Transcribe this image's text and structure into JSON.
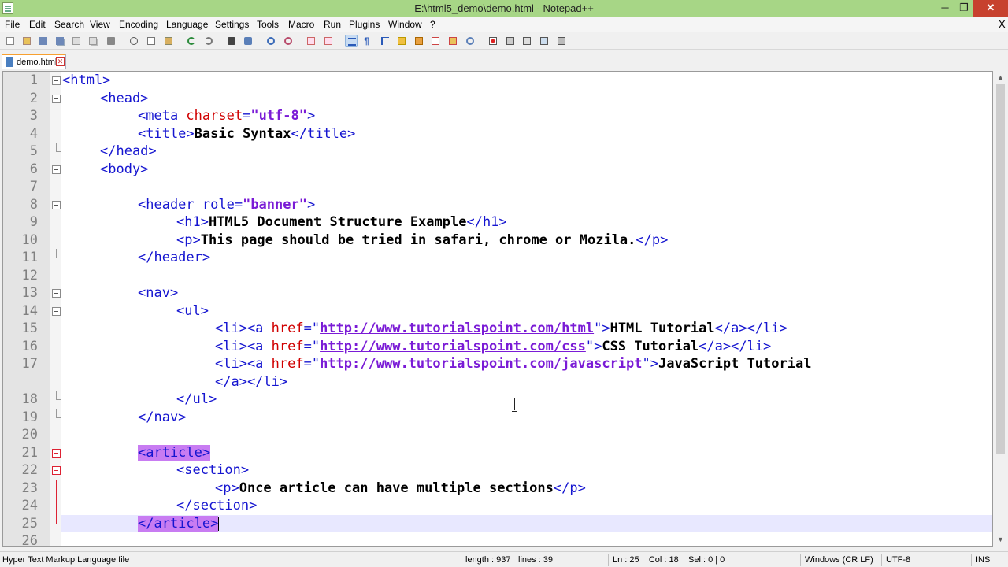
{
  "window": {
    "title": "E:\\html5_demo\\demo.html - Notepad++",
    "minimize_label": "─",
    "maximize_label": "❐",
    "close_label": "✕"
  },
  "menubar": {
    "items": [
      "File",
      "Edit",
      "Search",
      "View",
      "Encoding",
      "Language",
      "Settings",
      "Tools",
      "Macro",
      "Run",
      "Plugins",
      "Window",
      "?"
    ],
    "close_doc": "X"
  },
  "toolbar": {
    "buttons": [
      "new-file",
      "open-file",
      "save",
      "save-all",
      "close",
      "close-all",
      "print",
      "cut",
      "copy",
      "paste",
      "undo",
      "redo",
      "find",
      "replace",
      "zoom-in",
      "zoom-out",
      "sync-vertical",
      "sync-horizontal",
      "word-wrap",
      "show-all-chars",
      "indent-guide",
      "user-defined-language",
      "doc-map",
      "function-list",
      "folder-as-workspace",
      "monitoring",
      "record-macro",
      "stop-macro",
      "play-macro",
      "run-macro-multiple",
      "save-macro"
    ],
    "active": [
      "word-wrap"
    ]
  },
  "tabs": [
    {
      "label": "demo.html",
      "close": "✕"
    }
  ],
  "editor": {
    "current_line": 25,
    "lines": [
      {
        "n": "1"
      },
      {
        "n": "2"
      },
      {
        "n": "3"
      },
      {
        "n": "4"
      },
      {
        "n": "5"
      },
      {
        "n": "6"
      },
      {
        "n": "7"
      },
      {
        "n": "8"
      },
      {
        "n": "9"
      },
      {
        "n": "10"
      },
      {
        "n": "11"
      },
      {
        "n": "12"
      },
      {
        "n": "13"
      },
      {
        "n": "14"
      },
      {
        "n": "15"
      },
      {
        "n": "16"
      },
      {
        "n": "17"
      },
      {
        "n": ""
      },
      {
        "n": "18"
      },
      {
        "n": "19"
      },
      {
        "n": "20"
      },
      {
        "n": "21"
      },
      {
        "n": "22"
      },
      {
        "n": "23"
      },
      {
        "n": "24"
      },
      {
        "n": "25"
      },
      {
        "n": "26"
      }
    ],
    "text": {
      "l1": "<html>",
      "l2": "<head>",
      "l3_tag_open": "<meta ",
      "l3_attr": "charset",
      "l3_eq": "=",
      "l3_val": "\"utf-8\"",
      "l3_close": ">",
      "l4_open": "<title>",
      "l4_text": "Basic Syntax",
      "l4_close": "</title>",
      "l5": "</head>",
      "l6": "<body>",
      "l8_open": "<header ",
      "l8_attr": "role=",
      "l8_val": "\"banner\"",
      "l8_close": ">",
      "l9_open": "<h1>",
      "l9_text": "HTML5 Document Structure Example",
      "l9_close": "</h1>",
      "l10_open": "<p>",
      "l10_text": "This page should be tried in safari, chrome or Mozila.",
      "l10_close": "</p>",
      "l11": "</header>",
      "l13": "<nav>",
      "l14": "<ul>",
      "l15_open": "<li><a ",
      "l15_attr": "href",
      "l15_eq": "=\"",
      "l15_url": "http://www.tutorialspoint.com/html",
      "l15_q": "\">",
      "l15_text": "HTML Tutorial",
      "l15_close": "</a></li>",
      "l16_open": "<li><a ",
      "l16_attr": "href",
      "l16_eq": "=\"",
      "l16_url": "http://www.tutorialspoint.com/css",
      "l16_q": "\">",
      "l16_text": "CSS Tutorial",
      "l16_close": "</a></li>",
      "l17_open": "<li><a ",
      "l17_attr": "href",
      "l17_eq": "=\"",
      "l17_url": "http://www.tutorialspoint.com/javascript",
      "l17_q": "\">",
      "l17_text": "JavaScript Tutorial",
      "l17b": "</a></li>",
      "l18": "</ul>",
      "l19": "</nav>",
      "l21": "<article>",
      "l22": "<section>",
      "l23_open": "<p>",
      "l23_text": "Once article can have multiple sections",
      "l23_close": "</p>",
      "l24": "</section>",
      "l25": "</article>"
    }
  },
  "statusbar": {
    "file_type": "Hyper Text Markup Language file",
    "length": "length : 937",
    "lines": "lines : 39",
    "position": "Ln : 25    Col : 18    Sel : 0 | 0",
    "eol": "Windows (CR LF)",
    "encoding": "UTF-8",
    "mode": "INS"
  },
  "colors": {
    "titlebar": "#a7d686",
    "tag": "#1515d0",
    "attribute": "#d00000",
    "value": "#7a1bd6",
    "highlight": "#c87cf2",
    "current_line": "#e8e8ff"
  }
}
